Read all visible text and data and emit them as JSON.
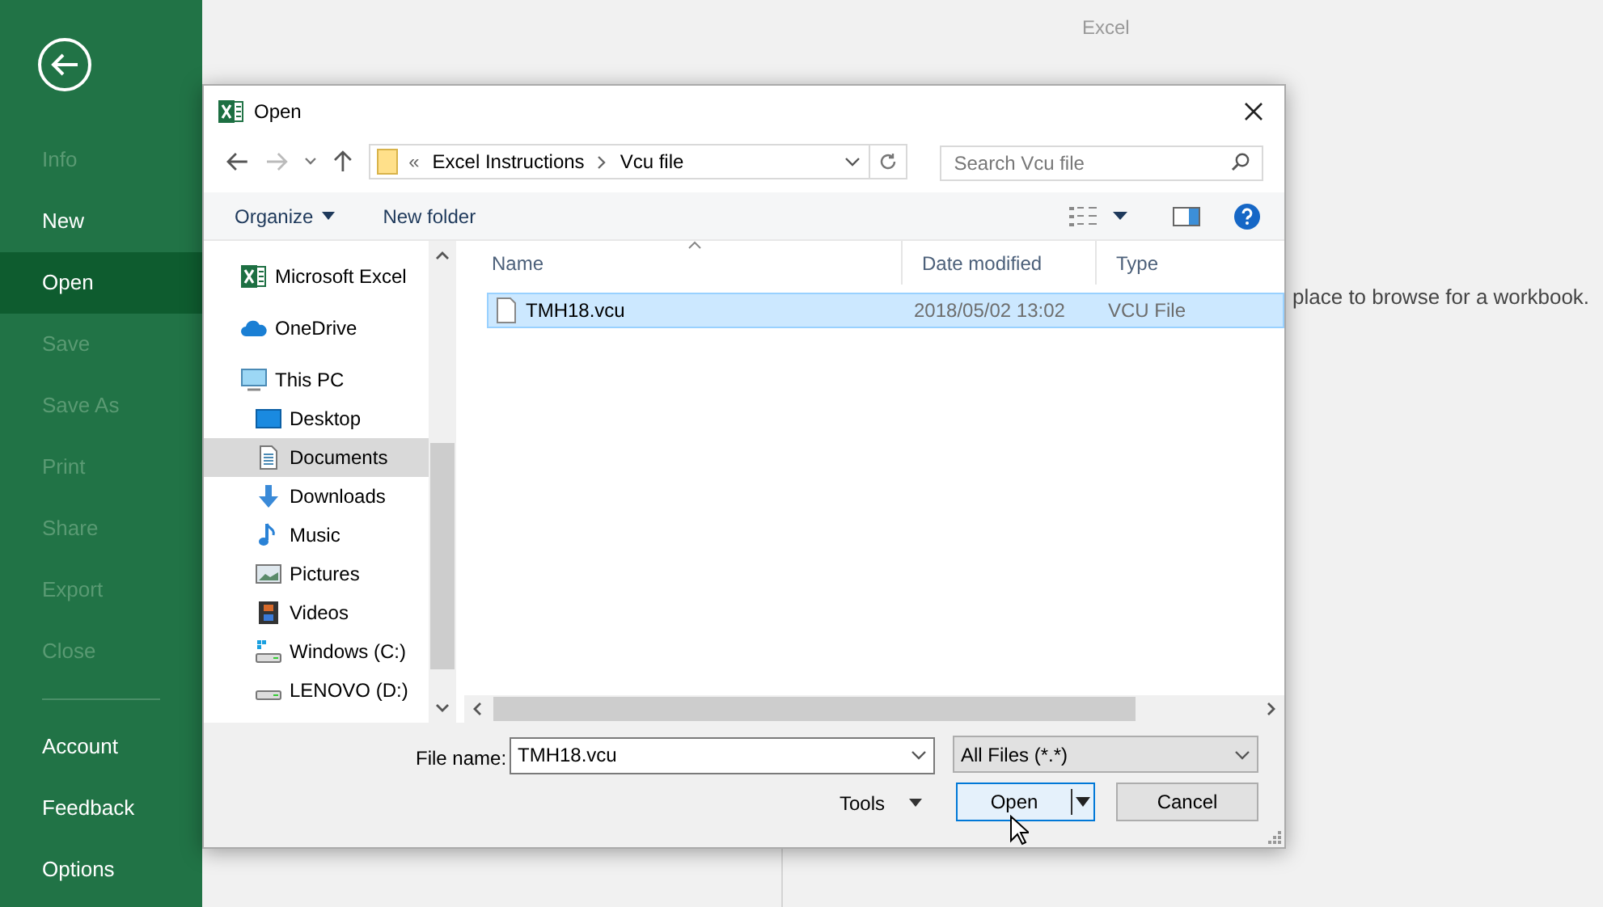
{
  "app_title": "Excel",
  "backstage": {
    "menu": [
      {
        "label": "Info",
        "disabled": true,
        "selected": false
      },
      {
        "label": "New",
        "disabled": false,
        "selected": false
      },
      {
        "label": "Open",
        "disabled": false,
        "selected": true
      },
      {
        "label": "Save",
        "disabled": true,
        "selected": false
      },
      {
        "label": "Save As",
        "disabled": true,
        "selected": false
      },
      {
        "label": "Print",
        "disabled": true,
        "selected": false
      },
      {
        "label": "Share",
        "disabled": true,
        "selected": false
      },
      {
        "label": "Export",
        "disabled": true,
        "selected": false
      },
      {
        "label": "Close",
        "disabled": true,
        "selected": false
      }
    ],
    "menu_bottom": [
      {
        "label": "Account",
        "disabled": false,
        "selected": false
      },
      {
        "label": "Feedback",
        "disabled": false,
        "selected": false
      },
      {
        "label": "Options",
        "disabled": false,
        "selected": false
      }
    ],
    "hint": "place to browse for a workbook."
  },
  "dialog": {
    "title": "Open",
    "breadcrumb": [
      "«",
      "Excel Instructions",
      "Vcu file"
    ],
    "search": {
      "placeholder": "Search Vcu file"
    },
    "toolbar": {
      "organize": "Organize",
      "new_folder": "New folder"
    },
    "nav": [
      {
        "label": "Microsoft Excel",
        "kind": "excel",
        "selected": false
      },
      {
        "label": "OneDrive",
        "kind": "cloud",
        "selected": false
      },
      {
        "label": "This PC",
        "kind": "pc",
        "selected": false,
        "children": [
          {
            "label": "Desktop",
            "kind": "desktop",
            "selected": false
          },
          {
            "label": "Documents",
            "kind": "documents",
            "selected": true
          },
          {
            "label": "Downloads",
            "kind": "downloads",
            "selected": false
          },
          {
            "label": "Music",
            "kind": "music",
            "selected": false
          },
          {
            "label": "Pictures",
            "kind": "pictures",
            "selected": false
          },
          {
            "label": "Videos",
            "kind": "videos",
            "selected": false
          },
          {
            "label": "Windows (C:)",
            "kind": "drive_windows",
            "selected": false
          },
          {
            "label": "LENOVO (D:)",
            "kind": "drive",
            "selected": false
          }
        ]
      }
    ],
    "columns": [
      "Name",
      "Date modified",
      "Type"
    ],
    "files": [
      {
        "name": "TMH18.vcu",
        "date": "2018/05/02 13:02",
        "type": "VCU File",
        "selected": true
      }
    ],
    "file_name_label": "File name:",
    "file_name": "TMH18.vcu",
    "filter": "All Files (*.*)",
    "tools": "Tools",
    "open": "Open",
    "cancel": "Cancel"
  }
}
